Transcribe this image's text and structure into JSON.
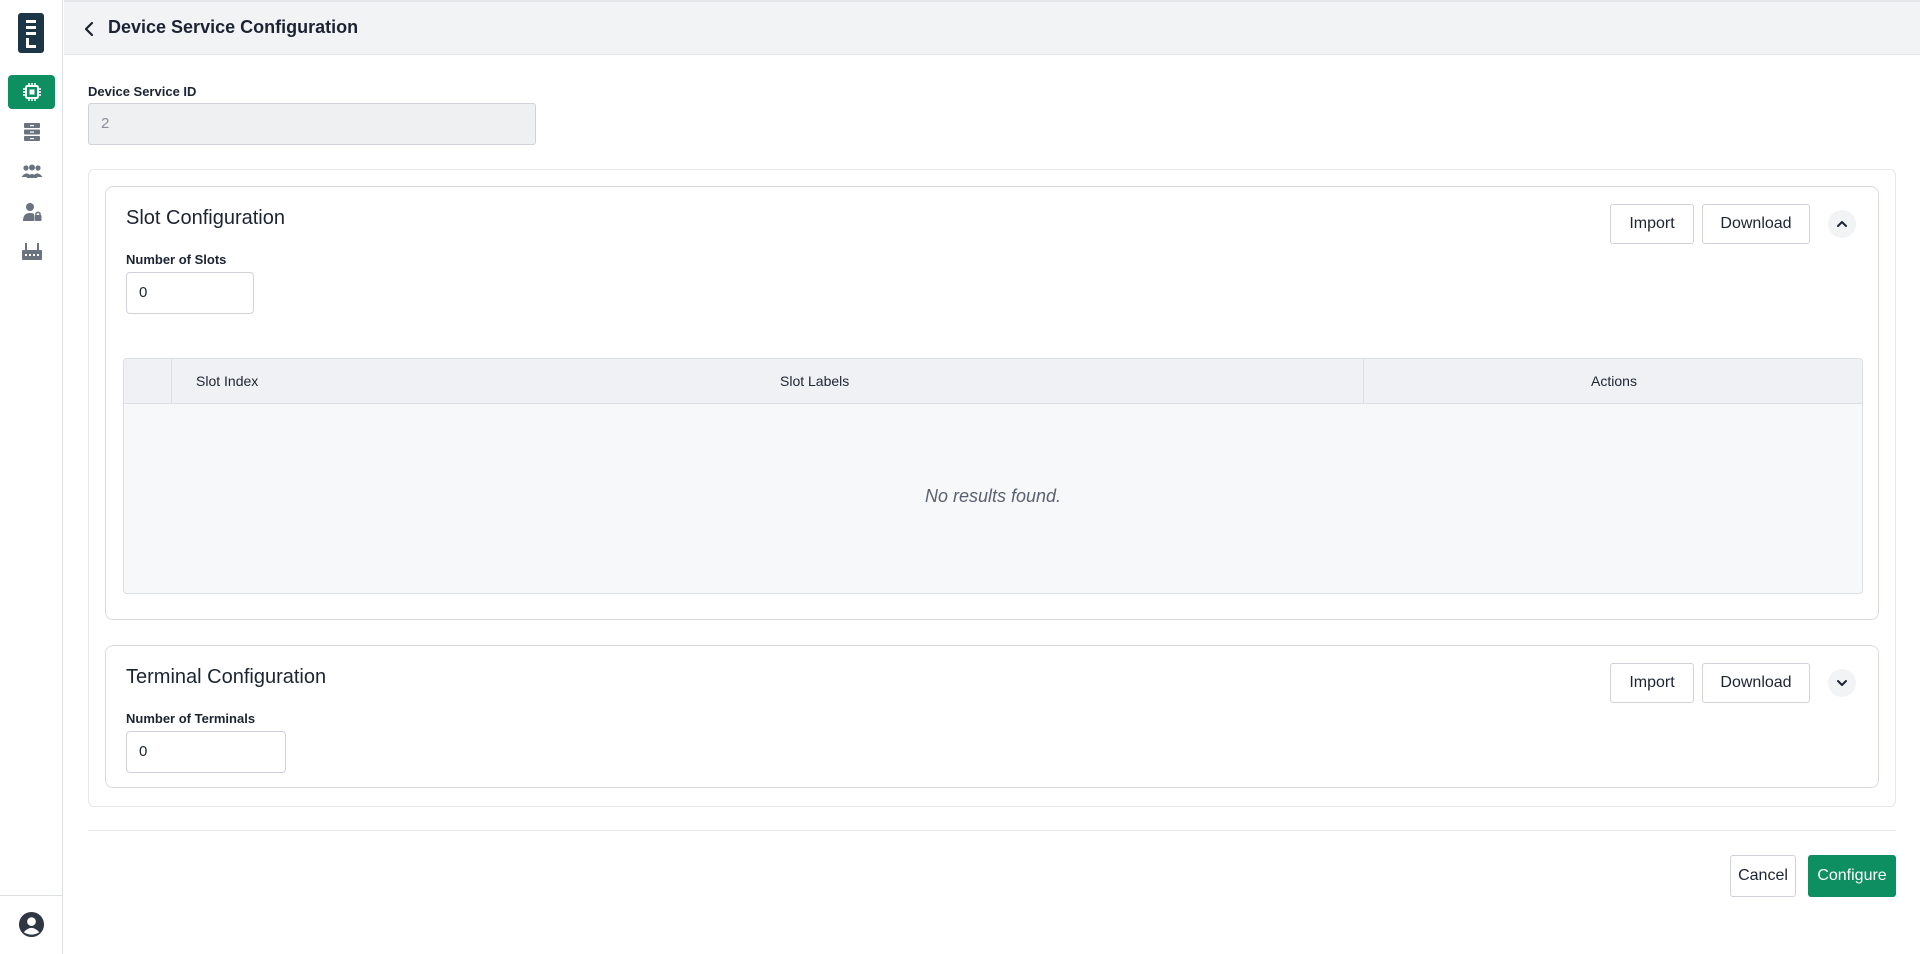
{
  "header": {
    "title": "Device Service Configuration",
    "back_icon": "chevron-left-icon"
  },
  "sidebar": {
    "logo": "L",
    "items": [
      {
        "name": "chip-icon",
        "active": true
      },
      {
        "name": "server-icon",
        "active": false
      },
      {
        "name": "users-icon",
        "active": false
      },
      {
        "name": "user-lock-icon",
        "active": false
      },
      {
        "name": "device-icon",
        "active": false
      }
    ],
    "bottom_icon": "user-circle-icon"
  },
  "device_service": {
    "label": "Device Service ID",
    "value": "2"
  },
  "slot_config": {
    "title": "Slot Configuration",
    "import_label": "Import",
    "download_label": "Download",
    "toggle_icon": "chevron-up-icon",
    "count_label": "Number of Slots",
    "count_value": "0",
    "table": {
      "columns": [
        "Slot Index",
        "Slot Labels",
        "Actions"
      ],
      "empty_message": "No results found."
    }
  },
  "terminal_config": {
    "title": "Terminal Configuration",
    "import_label": "Import",
    "download_label": "Download",
    "toggle_icon": "chevron-down-icon",
    "count_label": "Number of Terminals",
    "count_value": "0"
  },
  "footer": {
    "cancel_label": "Cancel",
    "configure_label": "Configure"
  },
  "colors": {
    "accent": "#0e8f62",
    "logo_bg": "#1d3647",
    "icon_gray": "#6b7280"
  }
}
